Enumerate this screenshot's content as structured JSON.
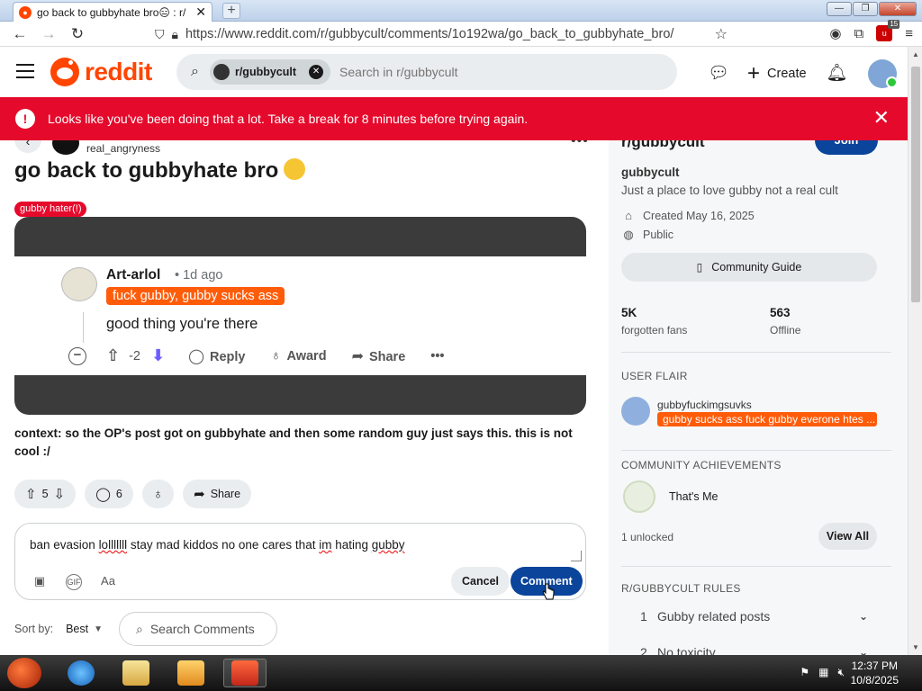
{
  "browser": {
    "tab_title": "go back to gubbyhate bro😑 : r/",
    "tab_close": "✕",
    "new_tab": "+",
    "url": "https://www.reddit.com/r/gubbycult/comments/1o192wa/go_back_to_gubbyhate_bro/",
    "extension_badge_count": "15"
  },
  "header": {
    "logo_text": "reddit",
    "search_chip": "r/gubbycult",
    "search_placeholder": "Search in r/gubbycult",
    "create_label": "Create"
  },
  "alert": {
    "message": "Looks like you've been doing that a lot. Take a break for 8 minutes before trying again.",
    "icon": "!"
  },
  "post": {
    "author": "real_angryness",
    "title": "go back to gubbyhate bro",
    "flair": "gubby hater(!)",
    "embedded_comment": {
      "user": "Art-arlol",
      "time": "• 1d ago",
      "flair": "fuck gubby, gubby sucks ass",
      "body": "good thing you're there",
      "score": "-2",
      "actions": [
        "Reply",
        "Award",
        "Share"
      ]
    },
    "context": "context: so the OP's post got on gubbyhate and then some random guy just says this. this is not cool :/",
    "votes": "5",
    "comments": "6",
    "share_label": "Share"
  },
  "composer": {
    "text_before": "ban evasion ",
    "text_err1": "lolllllll",
    "text_mid": " stay mad kiddos no one cares that ",
    "text_err2": "im",
    "text_mid2": " hating ",
    "text_err3": "gubby",
    "format_label": "Aa",
    "gif_label": "GIF",
    "cancel_label": "Cancel",
    "comment_label": "Comment"
  },
  "sort": {
    "label": "Sort by:",
    "value": "Best",
    "search_placeholder": "Search Comments"
  },
  "sidebar": {
    "name_header": "r/gubbycult",
    "join_label": "Join",
    "title": "gubbycult",
    "description": "Just a place to love gubby not a real cult",
    "created": "Created May 16, 2025",
    "visibility": "Public",
    "guide_label": "Community Guide",
    "stats": [
      {
        "value": "5K",
        "label": "forgotten fans"
      },
      {
        "value": "563",
        "label": "Offline"
      }
    ],
    "user_flair_header": "USER FLAIR",
    "user_flair_name": "gubbyfuckimgsuvks",
    "user_flair_text": "gubby sucks ass fuck gubby everone htes ...",
    "achievements_header": "COMMUNITY ACHIEVEMENTS",
    "achievement_name": "That's Me",
    "unlocked": "1 unlocked",
    "view_all": "View All",
    "rules_header": "R/GUBBYCULT RULES",
    "rules": [
      {
        "n": "1",
        "text": "Gubby related posts"
      },
      {
        "n": "2",
        "text": "No toxicity"
      }
    ]
  },
  "taskbar": {
    "time": "12:37 PM",
    "date": "10/8/2025"
  },
  "colors": {
    "reddit_orange": "#ff4500",
    "alert_red": "#e50a2c",
    "primary_blue": "#0a449b"
  }
}
